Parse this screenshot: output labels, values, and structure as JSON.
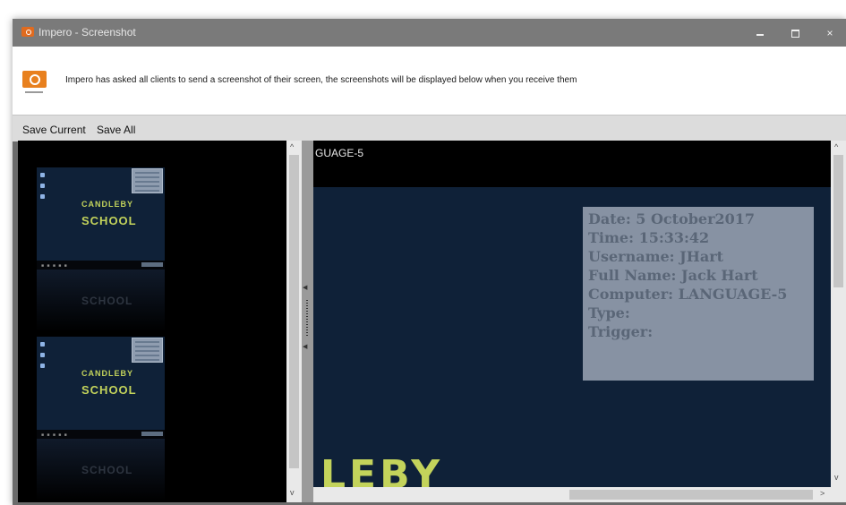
{
  "window": {
    "title": "Impero - Screenshot",
    "controls": {
      "minimize_icon": "minimize-icon",
      "maximize_icon": "maximize-icon",
      "close_label": "×"
    }
  },
  "info_bar": {
    "icon": "camera-icon",
    "message": "Impero has asked all clients to send a screenshot of their screen, the screenshots will be displayed below when you receive them"
  },
  "toolbar": {
    "save_current_label": "Save Current",
    "save_all_label": "Save All"
  },
  "thumbnails": [
    {
      "logo_line1": "CANDLEBY",
      "logo_line2": "SCHOOL",
      "reflection": "SCHOOL"
    },
    {
      "logo_line1": "CANDLEBY",
      "logo_line2": "SCHOOL",
      "reflection": "SCHOOL"
    }
  ],
  "preview": {
    "header_text": "GUAGE-5",
    "info_lines": [
      "Date: 5 October2017",
      "Time: 15:33:42",
      "Username: JHart",
      "Full Name: Jack Hart",
      "Computer: LANGUAGE-5",
      "Type:",
      "Trigger:"
    ],
    "logo_fragment": "LEBY"
  },
  "scroll": {
    "up": "^",
    "down": "v",
    "right": ">"
  },
  "colors": {
    "desktop_bg": "#0f2138",
    "logo_green": "#c3d35b",
    "accent_orange": "#e8801e",
    "titlebar": "#7a7a7a"
  }
}
